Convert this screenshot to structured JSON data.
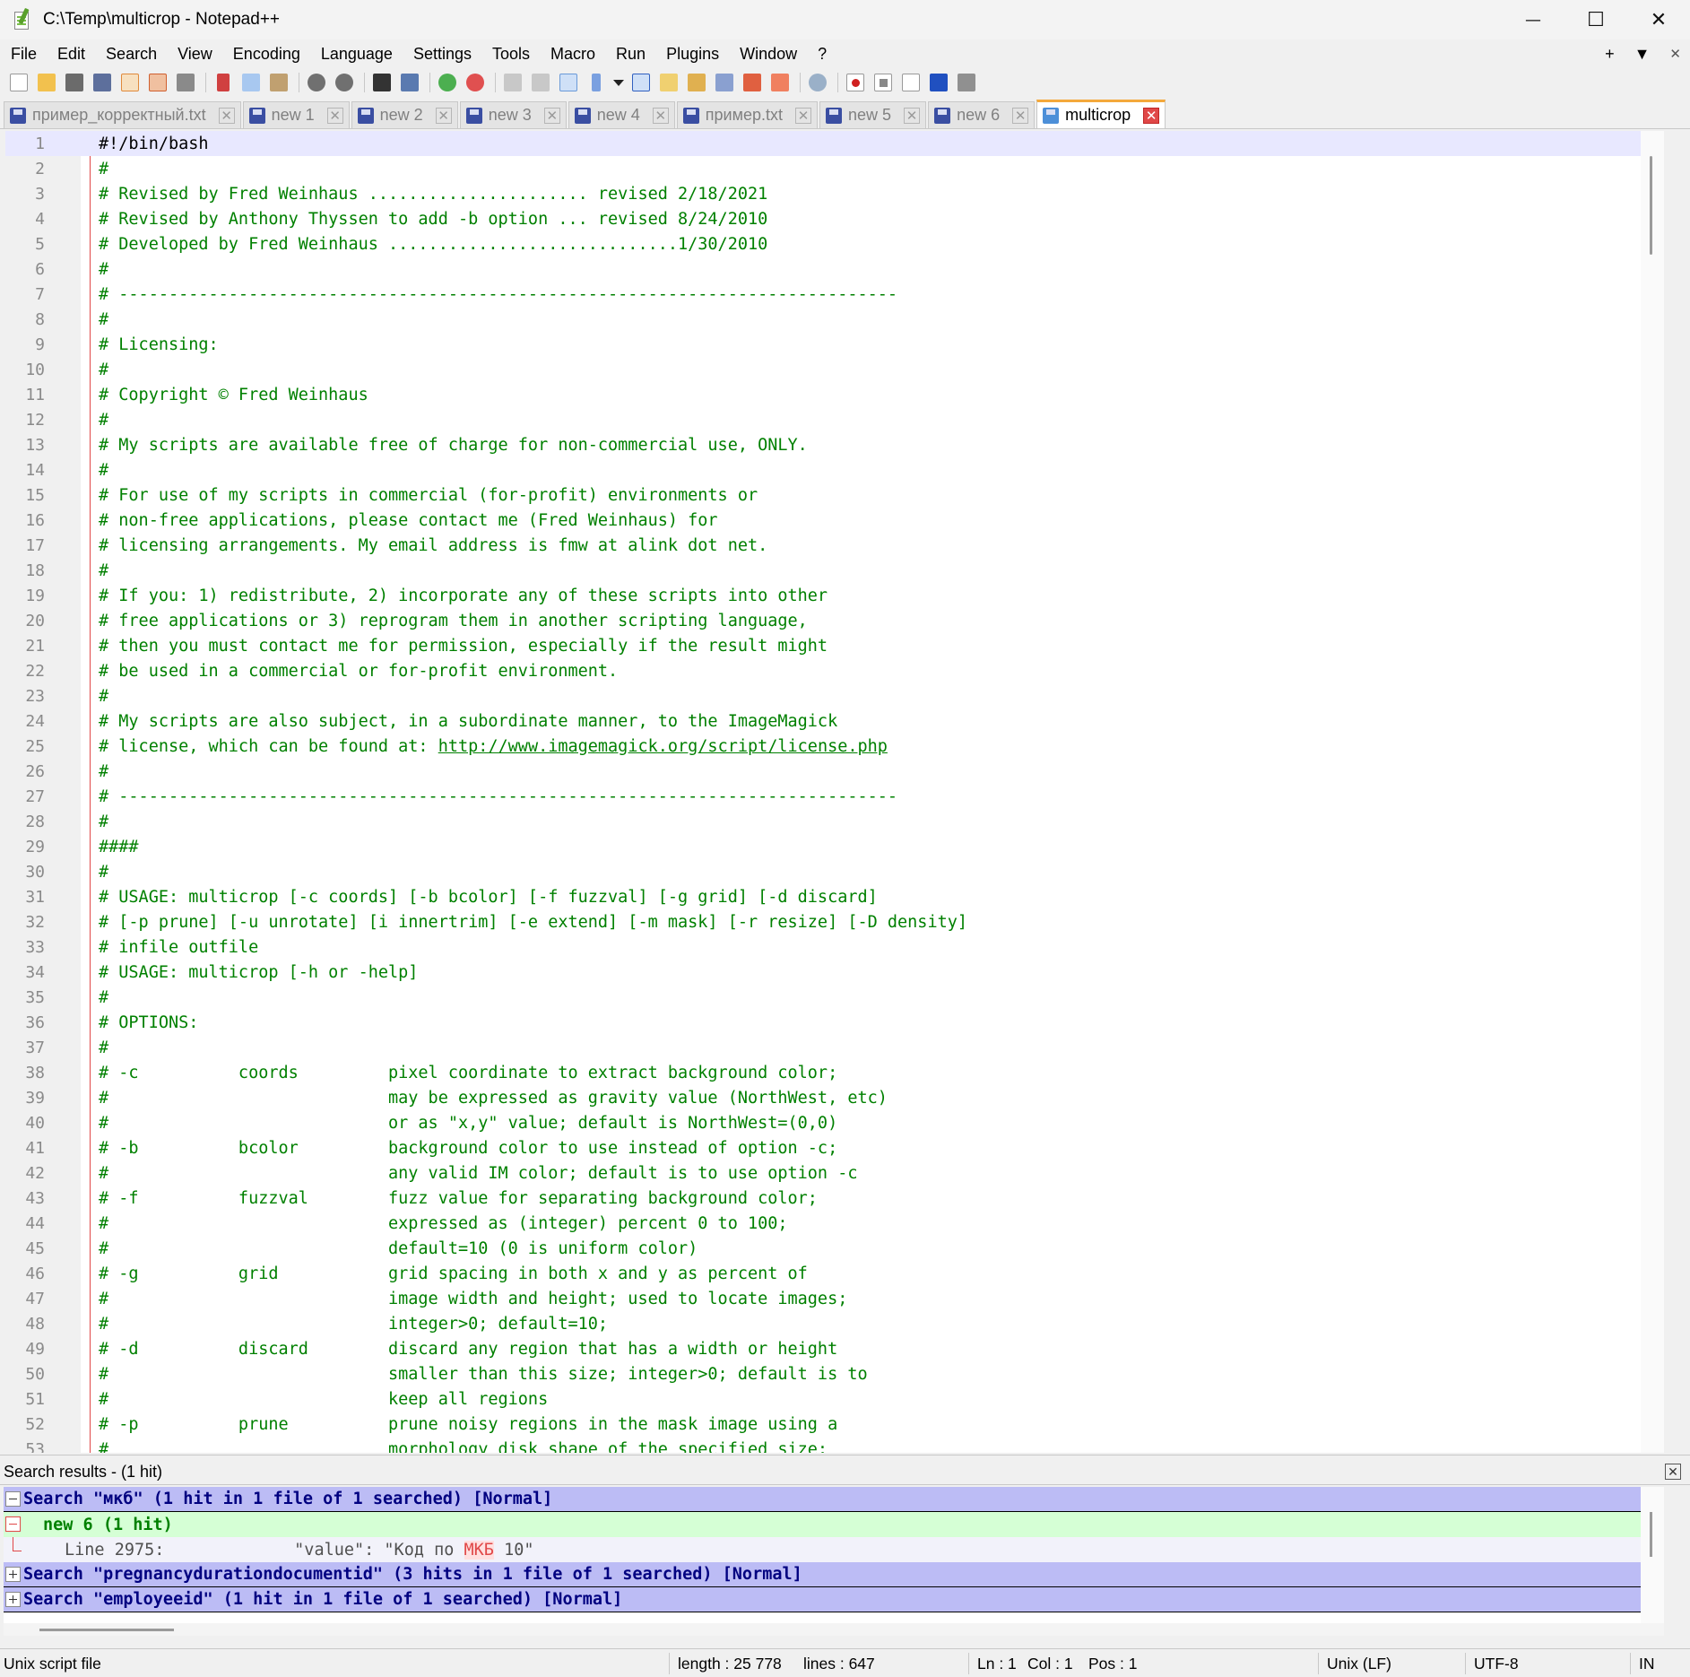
{
  "window": {
    "title": "C:\\Temp\\multicrop - Notepad++",
    "minimize": "—",
    "maximize": "☐",
    "close": "✕"
  },
  "menu": [
    "File",
    "Edit",
    "Search",
    "View",
    "Encoding",
    "Language",
    "Settings",
    "Tools",
    "Macro",
    "Run",
    "Plugins",
    "Window",
    "?"
  ],
  "menu_right": {
    "add": "+",
    "dropdown": "▼",
    "close": "✕"
  },
  "tabs": [
    {
      "label": "пример_корректный.txt",
      "active": false
    },
    {
      "label": "new 1",
      "active": false
    },
    {
      "label": "new 2",
      "active": false
    },
    {
      "label": "new 3",
      "active": false
    },
    {
      "label": "new 4",
      "active": false
    },
    {
      "label": "пример.txt",
      "active": false
    },
    {
      "label": "new 5",
      "active": false
    },
    {
      "label": "new 6",
      "active": false
    },
    {
      "label": "multicrop",
      "active": true
    }
  ],
  "tab_close": "✕",
  "editor_lines": [
    "#!/bin/bash",
    "#",
    "# Revised by Fred Weinhaus ...................... revised 2/18/2021",
    "# Revised by Anthony Thyssen to add -b option ... revised 8/24/2010",
    "# Developed by Fred Weinhaus .............................1/30/2010",
    "#",
    "# ------------------------------------------------------------------------------",
    "#",
    "# Licensing:",
    "#",
    "# Copyright © Fred Weinhaus",
    "#",
    "# My scripts are available free of charge for non-commercial use, ONLY.",
    "#",
    "# For use of my scripts in commercial (for-profit) environments or",
    "# non-free applications, please contact me (Fred Weinhaus) for",
    "# licensing arrangements. My email address is fmw at alink dot net.",
    "#",
    "# If you: 1) redistribute, 2) incorporate any of these scripts into other",
    "# free applications or 3) reprogram them in another scripting language,",
    "# then you must contact me for permission, especially if the result might",
    "# be used in a commercial or for-profit environment.",
    "#",
    "# My scripts are also subject, in a subordinate manner, to the ImageMagick",
    "# license, which can be found at: ",
    "#",
    "# ------------------------------------------------------------------------------",
    "#",
    "####",
    "#",
    "# USAGE: multicrop [-c coords] [-b bcolor] [-f fuzzval] [-g grid] [-d discard]",
    "# [-p prune] [-u unrotate] [i innertrim] [-e extend] [-m mask] [-r resize] [-D density]",
    "# infile outfile",
    "# USAGE: multicrop [-h or -help]",
    "#",
    "# OPTIONS:",
    "#",
    "# -c          coords         pixel coordinate to extract background color;",
    "#                            may be expressed as gravity value (NorthWest, etc)",
    "#                            or as \"x,y\" value; default is NorthWest=(0,0)",
    "# -b          bcolor         background color to use instead of option -c;",
    "#                            any valid IM color; default is to use option -c",
    "# -f          fuzzval        fuzz value for separating background color;",
    "#                            expressed as (integer) percent 0 to 100;",
    "#                            default=10 (0 is uniform color)",
    "# -g          grid           grid spacing in both x and y as percent of",
    "#                            image width and height; used to locate images;",
    "#                            integer>0; default=10;",
    "# -d          discard        discard any region that has a width or height",
    "#                            smaller than this size; integer>0; default is to",
    "#                            keep all regions",
    "# -p          prune          prune noisy regions in the mask image using a",
    "#                            morphology disk shape of the specified size;"
  ],
  "editor_url": "http://www.imagemagick.org/script/license.php",
  "search_panel": {
    "title": "Search results - (1 hit)",
    "close": "✕",
    "search1": "Search \"мкб\" (1 hit in 1 file of 1 searched) [Normal]",
    "file1": "new 6 (1 hit)",
    "hit_prefix": "Line 2975:             \"value\": \"Код по ",
    "hit_match": "МКБ",
    "hit_suffix": " 10\"",
    "search2": "Search \"pregnancydurationdocumentid\" (3 hits in 1 file of 1 searched) [Normal]",
    "search3": "Search \"employeeid\" (1 hit in 1 file of 1 searched) [Normal]"
  },
  "status": {
    "filetype": "Unix script file",
    "length": "length : 25 778",
    "lines": "lines : 647",
    "ln": "Ln : 1",
    "col": "Col : 1",
    "pos": "Pos : 1",
    "eol": "Unix (LF)",
    "encoding": "UTF-8",
    "mode": "IN"
  },
  "colors": {
    "comment": "#008000",
    "search_header_bg": "#bcbcf5",
    "file_header_bg": "#d5ffd5",
    "active_tab_accent": "#f4a93c",
    "fold_marker": "#e04848"
  }
}
